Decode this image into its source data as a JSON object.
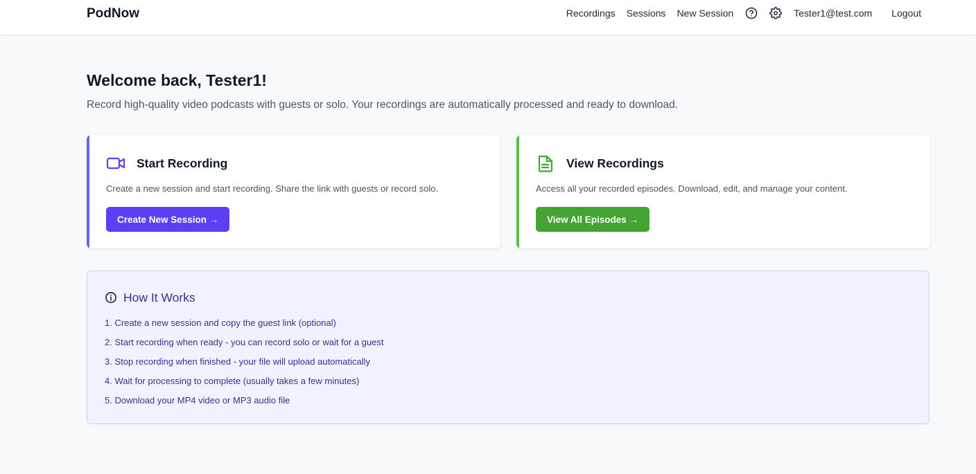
{
  "brand": "PodNow",
  "nav": {
    "recordings": "Recordings",
    "sessions": "Sessions",
    "new_session": "New Session",
    "help_icon": "help-circle-icon",
    "settings_icon": "gear-icon",
    "email": "Tester1@test.com",
    "logout": "Logout"
  },
  "welcome": {
    "title": "Welcome back, Tester1!",
    "subtitle": "Record high-quality video podcasts with guests or solo. Your recordings are automatically processed and ready to download."
  },
  "cards": [
    {
      "icon": "video-camera-icon",
      "title": "Start Recording",
      "description": "Create a new session and start recording. Share the link with guests or record solo.",
      "button": "Create New Session →",
      "accent_color": "#6366f1",
      "button_color": "#5a3ff5"
    },
    {
      "icon": "document-icon",
      "title": "View Recordings",
      "description": "Access all your recorded episodes. Download, edit, and manage your content.",
      "button": "View All Episodes →",
      "accent_color": "#5bbd45",
      "button_color": "#45a333"
    }
  ],
  "how_it_works": {
    "icon": "info-circle-icon",
    "title": "How It Works",
    "steps": [
      "1. Create a new session and copy the guest link (optional)",
      "2. Start recording when ready - you can record solo or wait for a guest",
      "3. Stop recording when finished - your file will upload automatically",
      "4. Wait for processing to complete (usually takes a few minutes)",
      "5. Download your MP4 video or MP3 audio file"
    ]
  }
}
